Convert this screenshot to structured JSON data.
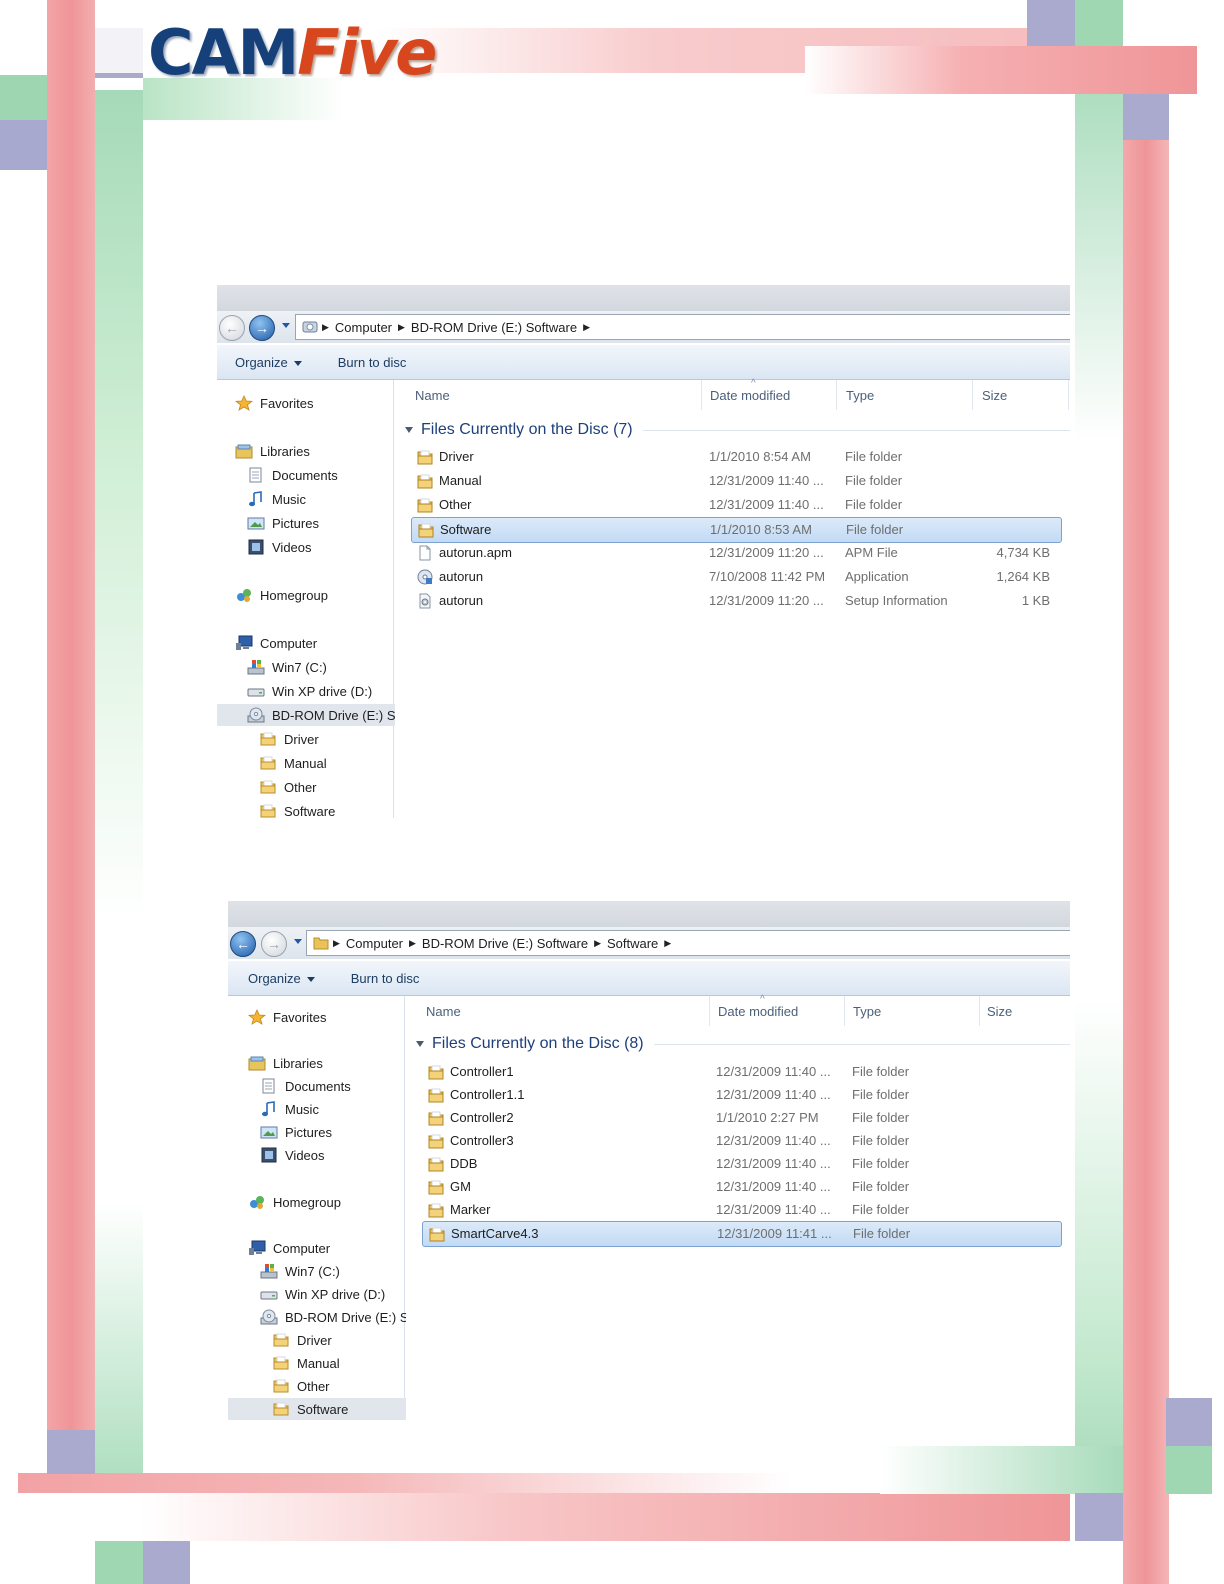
{
  "logo": {
    "part1": "CAM",
    "part2": "Five"
  },
  "colors": {
    "accent_blue": "#1e3f7a",
    "selection": "#c2daf5",
    "frame_pink": "#ef9ea0",
    "frame_green": "#9fd8b4",
    "frame_purple": "#a8acd0"
  },
  "windows": [
    {
      "nav_back": "←",
      "nav_forward": "→",
      "breadcrumb": [
        "Computer",
        "BD-ROM Drive (E:) Software"
      ],
      "toolbar": {
        "organize": "Organize",
        "burn": "Burn to disc"
      },
      "columns": [
        "Name",
        "Date modified",
        "Type",
        "Size"
      ],
      "group_title": "Files Currently on the Disc (7)",
      "nav": {
        "favorites": "Favorites",
        "libraries": "Libraries",
        "documents": "Documents",
        "music": "Music",
        "pictures": "Pictures",
        "videos": "Videos",
        "homegroup": "Homegroup",
        "computer": "Computer",
        "drive_c": "Win7 (C:)",
        "drive_d": "Win XP drive (D:)",
        "drive_e": "BD-ROM Drive (E:) S",
        "folders": [
          "Driver",
          "Manual",
          "Other",
          "Software"
        ]
      },
      "files": [
        {
          "name": "Driver",
          "date": "1/1/2010 8:54 AM",
          "type": "File folder",
          "size": "",
          "icon": "folder-icon"
        },
        {
          "name": "Manual",
          "date": "12/31/2009 11:40 ...",
          "type": "File folder",
          "size": "",
          "icon": "folder-icon"
        },
        {
          "name": "Other",
          "date": "12/31/2009 11:40 ...",
          "type": "File folder",
          "size": "",
          "icon": "folder-icon"
        },
        {
          "name": "Software",
          "date": "1/1/2010 8:53 AM",
          "type": "File folder",
          "size": "",
          "icon": "folder-icon"
        },
        {
          "name": "autorun.apm",
          "date": "12/31/2009 11:20 ...",
          "type": "APM File",
          "size": "4,734 KB",
          "icon": "file-icon"
        },
        {
          "name": "autorun",
          "date": "7/10/2008 11:42 PM",
          "type": "Application",
          "size": "1,264 KB",
          "icon": "application-icon"
        },
        {
          "name": "autorun",
          "date": "12/31/2009 11:20 ...",
          "type": "Setup Information",
          "size": "1 KB",
          "icon": "setup-file-icon"
        }
      ]
    },
    {
      "nav_back": "←",
      "nav_forward": "→",
      "breadcrumb": [
        "Computer",
        "BD-ROM Drive (E:) Software",
        "Software"
      ],
      "toolbar": {
        "organize": "Organize",
        "burn": "Burn to disc"
      },
      "columns": [
        "Name",
        "Date modified",
        "Type",
        "Size"
      ],
      "group_title": "Files Currently on the Disc (8)",
      "nav": {
        "favorites": "Favorites",
        "libraries": "Libraries",
        "documents": "Documents",
        "music": "Music",
        "pictures": "Pictures",
        "videos": "Videos",
        "homegroup": "Homegroup",
        "computer": "Computer",
        "drive_c": "Win7 (C:)",
        "drive_d": "Win XP drive (D:)",
        "drive_e": "BD-ROM Drive (E:) S",
        "folders": [
          "Driver",
          "Manual",
          "Other",
          "Software"
        ]
      },
      "files": [
        {
          "name": "Controller1",
          "date": "12/31/2009 11:40 ...",
          "type": "File folder",
          "size": "",
          "icon": "folder-icon"
        },
        {
          "name": "Controller1.1",
          "date": "12/31/2009 11:40 ...",
          "type": "File folder",
          "size": "",
          "icon": "folder-icon"
        },
        {
          "name": "Controller2",
          "date": "1/1/2010 2:27 PM",
          "type": "File folder",
          "size": "",
          "icon": "folder-icon"
        },
        {
          "name": "Controller3",
          "date": "12/31/2009 11:40 ...",
          "type": "File folder",
          "size": "",
          "icon": "folder-icon"
        },
        {
          "name": "DDB",
          "date": "12/31/2009 11:40 ...",
          "type": "File folder",
          "size": "",
          "icon": "folder-icon"
        },
        {
          "name": "GM",
          "date": "12/31/2009 11:40 ...",
          "type": "File folder",
          "size": "",
          "icon": "folder-icon"
        },
        {
          "name": "Marker",
          "date": "12/31/2009 11:40 ...",
          "type": "File folder",
          "size": "",
          "icon": "folder-icon"
        },
        {
          "name": "SmartCarve4.3",
          "date": "12/31/2009 11:41 ...",
          "type": "File folder",
          "size": "",
          "icon": "folder-icon"
        }
      ]
    }
  ]
}
